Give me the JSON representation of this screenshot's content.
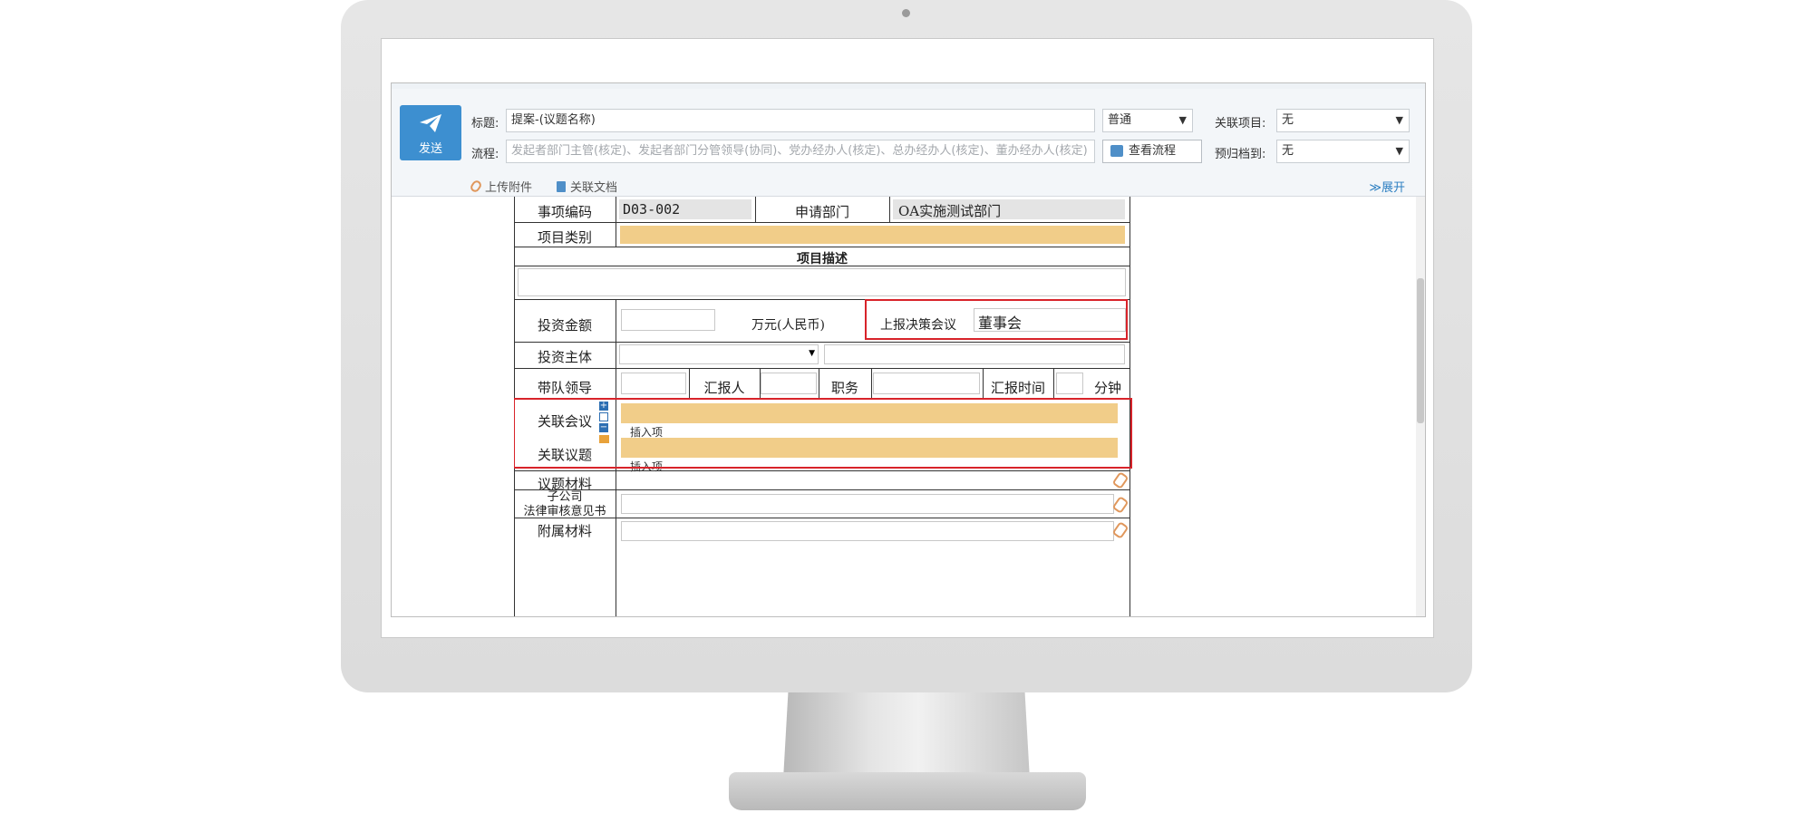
{
  "header": {
    "send_label": "发送",
    "title_label": "标题:",
    "title_value": "提案-(议题名称)",
    "priority_value": "普通",
    "related_project_label": "关联项目:",
    "related_project_value": "无",
    "flow_label": "流程:",
    "flow_placeholder": "发起者部门主管(核定)、发起者部门分管领导(协同)、党办经办人(核定)、总办经办人(核定)、董办经办人(核定)",
    "view_flow_label": "查看流程",
    "archive_label": "预归档到:",
    "archive_value": "无",
    "upload_label": "上传附件",
    "related_doc_label": "关联文档",
    "expand_label": "展开"
  },
  "form": {
    "item_code_label": "事项编码",
    "item_code_value": "D03-002",
    "dept_label": "申请部门",
    "dept_value": "OA实施测试部门",
    "category_label": "项目类别",
    "desc_label": "项目描述",
    "invest_amount_label": "投资金额",
    "invest_unit": "万元(人民币)",
    "report_meeting_label": "上报决策会议",
    "report_meeting_value": "董事会",
    "invest_subject_label": "投资主体",
    "leader_label": "带队领导",
    "reporter_label": "汇报人",
    "position_label": "职务",
    "report_time_label": "汇报时间",
    "minutes_label": "分钟",
    "related_meeting_label": "关联会议",
    "related_topic_label": "关联议题",
    "insert_item": "插入项",
    "topic_material_label": "议题材料",
    "subsidiary_label_1": "子公司",
    "subsidiary_label_2": "法律审核意见书",
    "attached_label": "附属材料"
  }
}
